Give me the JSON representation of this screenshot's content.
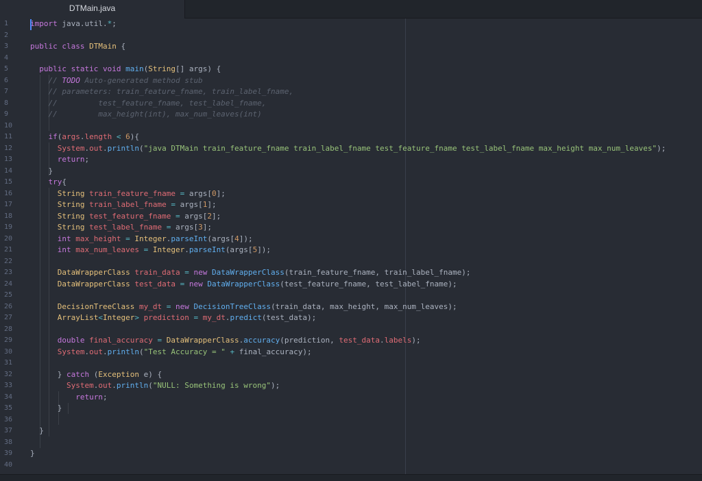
{
  "tab": {
    "title": "DTMain.java"
  },
  "theme": {
    "background": "#282c34",
    "keyword": "#c678dd",
    "type": "#e5c07b",
    "function": "#61afef",
    "string": "#98c379",
    "number": "#d19a66",
    "variable": "#e06c75",
    "comment": "#5c6370"
  },
  "line_numbers": [
    "1",
    "2",
    "3",
    "4",
    "5",
    "6",
    "7",
    "8",
    "9",
    "10",
    "11",
    "12",
    "13",
    "14",
    "15",
    "16",
    "17",
    "18",
    "19",
    "20",
    "21",
    "22",
    "23",
    "24",
    "25",
    "26",
    "27",
    "28",
    "29",
    "30",
    "31",
    "32",
    "33",
    "34",
    "35",
    "36",
    "37",
    "38",
    "39",
    "40"
  ],
  "code": [
    [
      [
        "kw",
        "import"
      ],
      [
        "pl",
        " java.util."
      ],
      [
        "op",
        "*"
      ],
      [
        "pl",
        ";"
      ]
    ],
    [],
    [
      [
        "kw",
        "public class "
      ],
      [
        "type",
        "DTMain"
      ],
      [
        "pl",
        " {"
      ]
    ],
    [],
    [
      [
        "pl",
        "  "
      ],
      [
        "kw",
        "public static void "
      ],
      [
        "fn",
        "main"
      ],
      [
        "pl",
        "("
      ],
      [
        "type",
        "String"
      ],
      [
        "pl",
        "[] args) {"
      ]
    ],
    [
      [
        "pl",
        "    "
      ],
      [
        "cm",
        "// "
      ],
      [
        "todo",
        "TODO"
      ],
      [
        "cm",
        " Auto-generated method stub"
      ]
    ],
    [
      [
        "pl",
        "    "
      ],
      [
        "cm",
        "// parameters: train_feature_fname, train_label_fname,"
      ]
    ],
    [
      [
        "pl",
        "    "
      ],
      [
        "cm",
        "//         test_feature_fname, test_label_fname,"
      ]
    ],
    [
      [
        "pl",
        "    "
      ],
      [
        "cm",
        "//         max_height(int), max_num_leaves(int)"
      ]
    ],
    [],
    [
      [
        "pl",
        "    "
      ],
      [
        "kw",
        "if"
      ],
      [
        "pl",
        "("
      ],
      [
        "var",
        "args"
      ],
      [
        "pl",
        "."
      ],
      [
        "var",
        "length"
      ],
      [
        "op",
        " < "
      ],
      [
        "num",
        "6"
      ],
      [
        "pl",
        "){"
      ]
    ],
    [
      [
        "pl",
        "      "
      ],
      [
        "var",
        "System"
      ],
      [
        "pl",
        "."
      ],
      [
        "var",
        "out"
      ],
      [
        "pl",
        "."
      ],
      [
        "fn",
        "println"
      ],
      [
        "pl",
        "("
      ],
      [
        "str",
        "\"java DTMain train_feature_fname train_label_fname test_feature_fname test_label_fname max_height max_num_leaves\""
      ],
      [
        "pl",
        ");"
      ]
    ],
    [
      [
        "pl",
        "      "
      ],
      [
        "kw",
        "return"
      ],
      [
        "pl",
        ";"
      ]
    ],
    [
      [
        "pl",
        "    }"
      ]
    ],
    [
      [
        "pl",
        "    "
      ],
      [
        "kw",
        "try"
      ],
      [
        "pl",
        "{"
      ]
    ],
    [
      [
        "pl",
        "      "
      ],
      [
        "type",
        "String "
      ],
      [
        "var",
        "train_feature_fname"
      ],
      [
        "op",
        " = "
      ],
      [
        "pl",
        "args["
      ],
      [
        "num",
        "0"
      ],
      [
        "pl",
        "];"
      ]
    ],
    [
      [
        "pl",
        "      "
      ],
      [
        "type",
        "String "
      ],
      [
        "var",
        "train_label_fname"
      ],
      [
        "op",
        " = "
      ],
      [
        "pl",
        "args["
      ],
      [
        "num",
        "1"
      ],
      [
        "pl",
        "];"
      ]
    ],
    [
      [
        "pl",
        "      "
      ],
      [
        "type",
        "String "
      ],
      [
        "var",
        "test_feature_fname"
      ],
      [
        "op",
        " = "
      ],
      [
        "pl",
        "args["
      ],
      [
        "num",
        "2"
      ],
      [
        "pl",
        "];"
      ]
    ],
    [
      [
        "pl",
        "      "
      ],
      [
        "type",
        "String "
      ],
      [
        "var",
        "test_label_fname"
      ],
      [
        "op",
        " = "
      ],
      [
        "pl",
        "args["
      ],
      [
        "num",
        "3"
      ],
      [
        "pl",
        "];"
      ]
    ],
    [
      [
        "pl",
        "      "
      ],
      [
        "kw",
        "int "
      ],
      [
        "var",
        "max_height"
      ],
      [
        "op",
        " = "
      ],
      [
        "type",
        "Integer"
      ],
      [
        "pl",
        "."
      ],
      [
        "fn",
        "parseInt"
      ],
      [
        "pl",
        "(args["
      ],
      [
        "num",
        "4"
      ],
      [
        "pl",
        "]);"
      ]
    ],
    [
      [
        "pl",
        "      "
      ],
      [
        "kw",
        "int "
      ],
      [
        "var",
        "max_num_leaves"
      ],
      [
        "op",
        " = "
      ],
      [
        "type",
        "Integer"
      ],
      [
        "pl",
        "."
      ],
      [
        "fn",
        "parseInt"
      ],
      [
        "pl",
        "(args["
      ],
      [
        "num",
        "5"
      ],
      [
        "pl",
        "]);"
      ]
    ],
    [],
    [
      [
        "pl",
        "      "
      ],
      [
        "type",
        "DataWrapperClass "
      ],
      [
        "var",
        "train_data"
      ],
      [
        "op",
        " = "
      ],
      [
        "kw",
        "new "
      ],
      [
        "fn",
        "DataWrapperClass"
      ],
      [
        "pl",
        "(train_feature_fname, train_label_fname);"
      ]
    ],
    [
      [
        "pl",
        "      "
      ],
      [
        "type",
        "DataWrapperClass "
      ],
      [
        "var",
        "test_data"
      ],
      [
        "op",
        " = "
      ],
      [
        "kw",
        "new "
      ],
      [
        "fn",
        "DataWrapperClass"
      ],
      [
        "pl",
        "(test_feature_fname, test_label_fname);"
      ]
    ],
    [],
    [
      [
        "pl",
        "      "
      ],
      [
        "type",
        "DecisionTreeClass "
      ],
      [
        "var",
        "my_dt"
      ],
      [
        "op",
        " = "
      ],
      [
        "kw",
        "new "
      ],
      [
        "fn",
        "DecisionTreeClass"
      ],
      [
        "pl",
        "(train_data, max_height, max_num_leaves);"
      ]
    ],
    [
      [
        "pl",
        "      "
      ],
      [
        "type",
        "ArrayList"
      ],
      [
        "op",
        "<"
      ],
      [
        "type",
        "Integer"
      ],
      [
        "op",
        "> "
      ],
      [
        "var",
        "prediction"
      ],
      [
        "op",
        " = "
      ],
      [
        "var",
        "my_dt"
      ],
      [
        "pl",
        "."
      ],
      [
        "fn",
        "predict"
      ],
      [
        "pl",
        "(test_data);"
      ]
    ],
    [],
    [
      [
        "pl",
        "      "
      ],
      [
        "kw",
        "double "
      ],
      [
        "var",
        "final_accuracy"
      ],
      [
        "op",
        " = "
      ],
      [
        "type",
        "DataWrapperClass"
      ],
      [
        "pl",
        "."
      ],
      [
        "fn",
        "accuracy"
      ],
      [
        "pl",
        "(prediction, "
      ],
      [
        "var",
        "test_data"
      ],
      [
        "pl",
        "."
      ],
      [
        "var",
        "labels"
      ],
      [
        "pl",
        ");"
      ]
    ],
    [
      [
        "pl",
        "      "
      ],
      [
        "var",
        "System"
      ],
      [
        "pl",
        "."
      ],
      [
        "var",
        "out"
      ],
      [
        "pl",
        "."
      ],
      [
        "fn",
        "println"
      ],
      [
        "pl",
        "("
      ],
      [
        "str",
        "\"Test Accuracy = \""
      ],
      [
        "op",
        " + "
      ],
      [
        "pl",
        "final_accuracy);"
      ]
    ],
    [],
    [
      [
        "pl",
        "      } "
      ],
      [
        "kw",
        "catch"
      ],
      [
        "pl",
        " ("
      ],
      [
        "type",
        "Exception"
      ],
      [
        "pl",
        " e) {"
      ]
    ],
    [
      [
        "pl",
        "        "
      ],
      [
        "var",
        "System"
      ],
      [
        "pl",
        "."
      ],
      [
        "var",
        "out"
      ],
      [
        "pl",
        "."
      ],
      [
        "fn",
        "println"
      ],
      [
        "pl",
        "("
      ],
      [
        "str",
        "\"NULL: Something is wrong\""
      ],
      [
        "pl",
        ");"
      ]
    ],
    [
      [
        "pl",
        "          "
      ],
      [
        "kw",
        "return"
      ],
      [
        "pl",
        ";"
      ]
    ],
    [
      [
        "pl",
        "      }"
      ]
    ],
    [],
    [
      [
        "pl",
        "  }"
      ]
    ],
    [],
    [
      [
        "pl",
        "}"
      ]
    ],
    []
  ]
}
